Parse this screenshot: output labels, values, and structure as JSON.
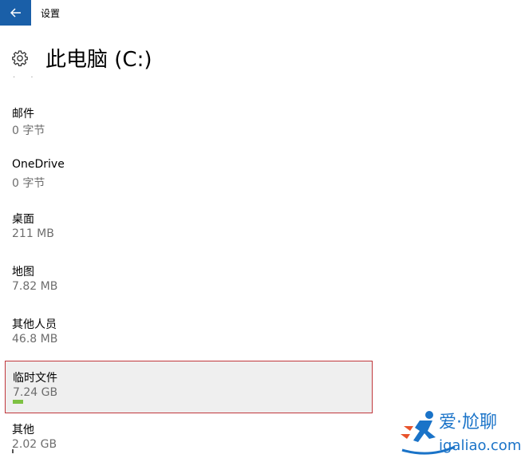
{
  "window": {
    "title": "设置"
  },
  "header": {
    "title": "此电脑 (C:)"
  },
  "items": [
    {
      "name": "邮件",
      "size": "0 字节"
    },
    {
      "name": "OneDrive",
      "size": "0 字节"
    },
    {
      "name": "桌面",
      "size": "211 MB"
    },
    {
      "name": "地图",
      "size": "7.82 MB"
    },
    {
      "name": "其他人员",
      "size": "46.8 MB"
    },
    {
      "name": "临时文件",
      "size": "7.24 GB",
      "usage_fraction": 0.03,
      "selected": true
    },
    {
      "name": "其他",
      "size": "2.02 GB"
    }
  ],
  "watermark": {
    "brand": "爱·尬聊",
    "url": "igaliao.com"
  },
  "colors": {
    "accent": "#1a5fa8",
    "selection_border": "#c0373c",
    "usage_bar": "#7ec142",
    "secondary_text": "#6d6d6d"
  },
  "icons": {
    "back": "back-arrow-icon",
    "settings": "gear-icon"
  }
}
